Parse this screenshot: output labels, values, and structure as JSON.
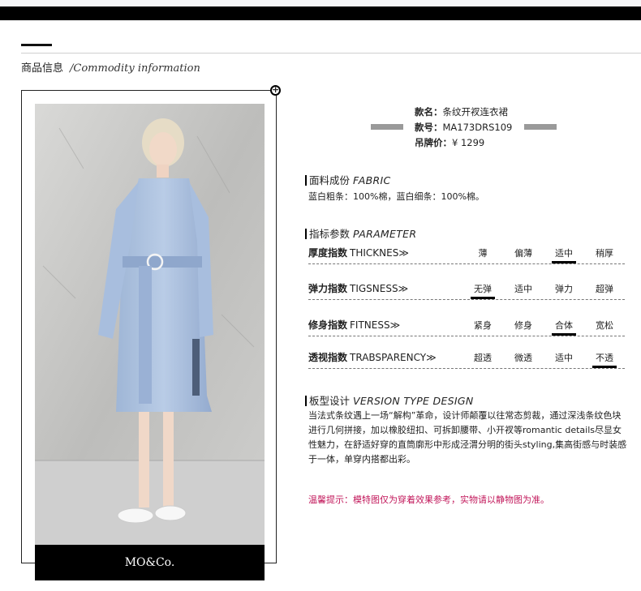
{
  "section": {
    "title_cn": "商品信息",
    "title_en": "/Commodity information"
  },
  "brand": "MO&Co.",
  "product": {
    "name_label": "款名：",
    "name": "条纹开衩连衣裙",
    "code_label": "款号：",
    "code": "MA173DRS109",
    "price_label": "吊牌价：",
    "price": "¥ 1299"
  },
  "fabric": {
    "title_cn": "面料成份",
    "title_en": "FABRIC",
    "text": "蓝白粗条：100%棉，蓝白细条：100%棉。"
  },
  "parameter": {
    "title_cn": "指标参数",
    "title_en": "PARAMETER",
    "rows": [
      {
        "label_cn": "厚度指数",
        "label_en": "THICKNES≫",
        "options": [
          "薄",
          "偏薄",
          "适中",
          "稍厚"
        ],
        "selected_index": 2
      },
      {
        "label_cn": "弹力指数",
        "label_en": "TIGSNESS≫",
        "options": [
          "无弹",
          "适中",
          "弹力",
          "超弹"
        ],
        "selected_index": 0
      },
      {
        "label_cn": "修身指数",
        "label_en": "FITNESS≫",
        "options": [
          "紧身",
          "修身",
          "合体",
          "宽松"
        ],
        "selected_index": 2
      },
      {
        "label_cn": "透视指数",
        "label_en": "TRABSPARENCY≫",
        "options": [
          "超透",
          "微透",
          "适中",
          "不透"
        ],
        "selected_index": 3
      }
    ]
  },
  "design": {
    "title_cn": "板型设计",
    "title_en": "VERSION TYPE DESIGN",
    "text": "当法式条纹遇上一场“解构”革命，设计师颠覆以往常态剪裁，通过深浅条纹色块进行几何拼接，加以橡胶纽扣、可拆卸腰带、小开衩等romantic details尽显女性魅力，在舒适好穿的直筒廓形中形成泾渭分明的街头styling,集高街感与时装感于一体，单穿内搭都出彩。"
  },
  "notice": "温馨提示：模特图仅为穿着效果参考，实物请以静物图为准。",
  "icons": {
    "expand": "plus-circle-icon"
  }
}
